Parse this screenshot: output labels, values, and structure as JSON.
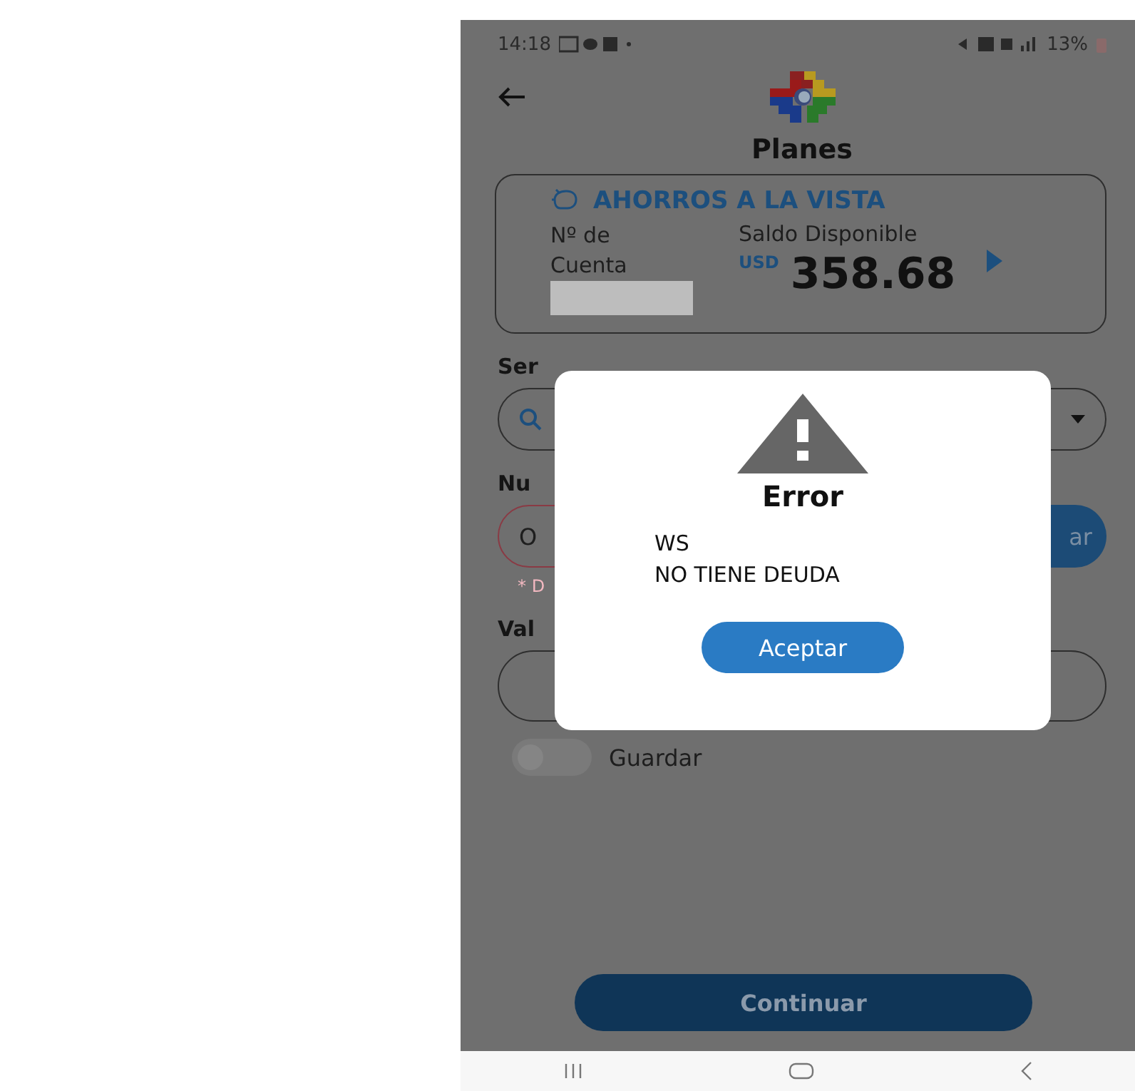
{
  "status_bar": {
    "time": "14:18",
    "battery": "13%"
  },
  "header": {
    "title": "Planes"
  },
  "account_card": {
    "type": "AHORROS A LA VISTA",
    "number_label": "Nº de\nCuenta",
    "balance_label": "Saldo Disponible",
    "currency": "USD",
    "balance": "358.68"
  },
  "form": {
    "service_label": "Ser",
    "number_label": "Nu",
    "number_value": "O",
    "number_invalid": true,
    "button_label": "ar",
    "hint": "* D",
    "value_label": "Val",
    "save_toggle": {
      "label": "Guardar",
      "on": false
    },
    "continue_button": "Continuar"
  },
  "dialog": {
    "title": "Error",
    "message": [
      "WS",
      "NO TIENE DEUDA"
    ],
    "button": "Aceptar"
  }
}
